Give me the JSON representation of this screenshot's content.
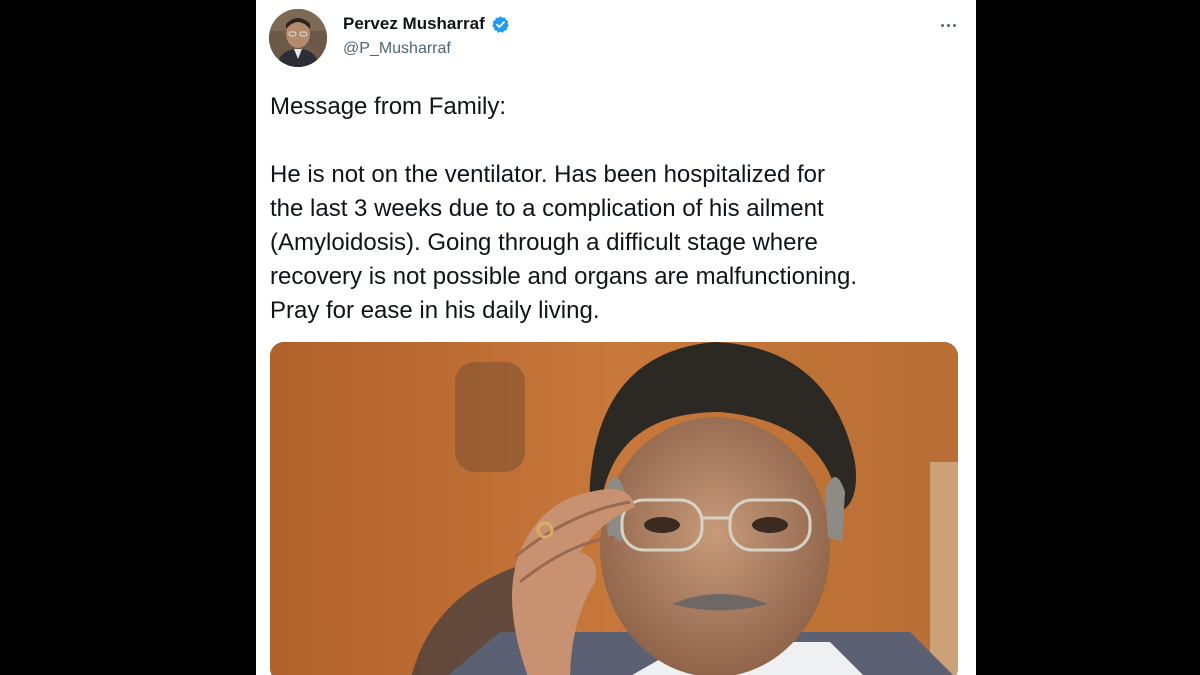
{
  "tweet": {
    "author_name": "Pervez Musharraf",
    "author_handle": "@P_Musharraf",
    "verified": true,
    "text_lines": [
      "Message from Family:",
      "",
      "He is not on the ventilator. Has been hospitalized for",
      "the last 3 weeks due to a complication of his ailment",
      "(Amyloidosis).  Going through a difficult stage where",
      "recovery is not possible and organs are malfunctioning.",
      "Pray for ease in his daily living."
    ],
    "icons": {
      "verified": "verified-badge-icon",
      "more": "more-options-icon"
    },
    "colors": {
      "verified": "#1d9bf0",
      "name": "#0f1419",
      "handle": "#536471",
      "background": "#000000",
      "card": "#ffffff"
    }
  }
}
